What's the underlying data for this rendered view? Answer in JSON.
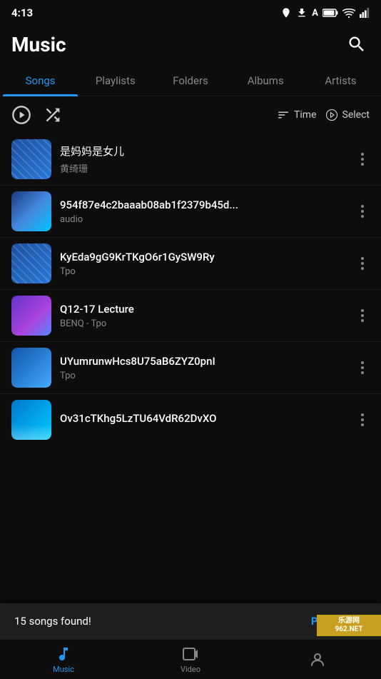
{
  "statusBar": {
    "time": "4:13",
    "icons": [
      "location",
      "download",
      "a",
      "battery"
    ]
  },
  "header": {
    "title": "Music",
    "searchLabel": "Search"
  },
  "tabs": [
    {
      "id": "songs",
      "label": "Songs",
      "active": true
    },
    {
      "id": "playlists",
      "label": "Playlists",
      "active": false
    },
    {
      "id": "folders",
      "label": "Folders",
      "active": false
    },
    {
      "id": "albums",
      "label": "Albums",
      "active": false
    },
    {
      "id": "artists",
      "label": "Artists",
      "active": false
    }
  ],
  "toolbar": {
    "playLabel": "",
    "shuffleLabel": "",
    "timeLabel": "Time",
    "selectLabel": "Select"
  },
  "songs": [
    {
      "id": 1,
      "title": "是妈妈是女儿",
      "artist": "黄绮珊",
      "thumb": "zigzag"
    },
    {
      "id": 2,
      "title": "954f87e4c2baaab08ab1f2379b45d...",
      "artist": "audio",
      "thumb": "gradient1"
    },
    {
      "id": 3,
      "title": "KyEda9gG9KrTKgO6r1GySW9Ry",
      "artist": "Tpo",
      "thumb": "zigzag"
    },
    {
      "id": 4,
      "title": "Q12-17 Lecture",
      "artist": "BENQ - Tpo",
      "thumb": "gradient2"
    },
    {
      "id": 5,
      "title": "UYumrunwHcs8U75aB6ZYZ0pnI",
      "artist": "Tpo",
      "thumb": "gradient3"
    },
    {
      "id": 6,
      "title": "Ov31cTKhg5LzTU64VdR62DvXO",
      "artist": "",
      "thumb": "gradient5"
    }
  ],
  "banner": {
    "text": "15 songs found!",
    "buttonLabel": "PLAY NOW"
  },
  "bottomNav": [
    {
      "id": "music",
      "label": "Music",
      "active": true
    },
    {
      "id": "video",
      "label": "Video",
      "active": false
    },
    {
      "id": "profile",
      "label": "",
      "active": false
    }
  ],
  "watermark": {
    "text": "乐游网",
    "subtext": "962.NET"
  }
}
